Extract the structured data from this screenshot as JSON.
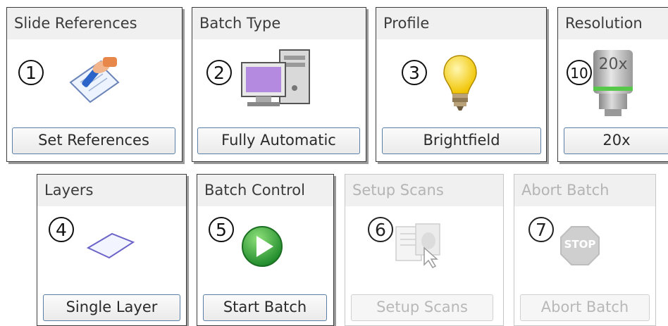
{
  "panels": [
    {
      "title": "Slide References",
      "number": "1",
      "button": "Set References",
      "icon": "pen-paper-icon",
      "enabled": true
    },
    {
      "title": "Batch Type",
      "number": "2",
      "button": "Fully Automatic",
      "icon": "computer-icon",
      "enabled": true
    },
    {
      "title": "Profile",
      "number": "3",
      "button": "Brightfield",
      "icon": "light-bulb-icon",
      "enabled": true
    },
    {
      "title": "Resolution",
      "number": "10",
      "button": "20x",
      "icon": "objective-lens-icon",
      "lens_label": "20x",
      "enabled": true
    },
    {
      "title": "Layers",
      "number": "4",
      "button": "Single Layer",
      "icon": "slide-layer-icon",
      "enabled": true
    },
    {
      "title": "Batch Control",
      "number": "5",
      "button": "Start Batch",
      "icon": "play-icon",
      "enabled": true
    },
    {
      "title": "Setup Scans",
      "number": "6",
      "button": "Setup Scans",
      "icon": "setup-scans-icon",
      "enabled": false
    },
    {
      "title": "Abort Batch",
      "number": "7",
      "button": "Abort Batch",
      "icon": "stop-sign-icon",
      "stop_label": "STOP",
      "enabled": false
    }
  ],
  "colors": {
    "accent_border": "#5a7fa6",
    "disabled_text": "#b4b4b4",
    "panel_header": "#f0f0f0"
  }
}
